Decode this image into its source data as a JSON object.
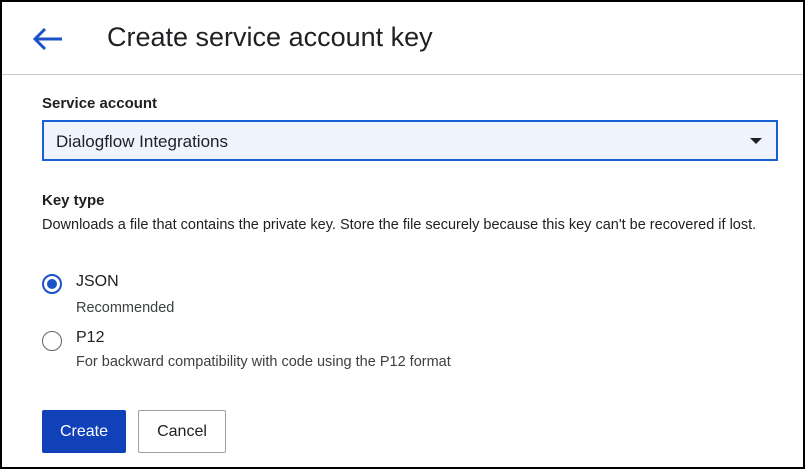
{
  "header": {
    "back_icon": "arrow-left-icon",
    "title": "Create service account key"
  },
  "service_account": {
    "label": "Service account",
    "selected": "Dialogflow Integrations",
    "dropdown_icon": "caret-down-icon"
  },
  "key_type": {
    "label": "Key type",
    "description": "Downloads a file that contains the private key. Store the file securely because this key can't be recovered if lost.",
    "options": [
      {
        "label": "JSON",
        "sublabel": "Recommended",
        "checked": true
      },
      {
        "label": "P12",
        "sublabel": "For backward compatibility with code using the P12 format",
        "checked": false
      }
    ]
  },
  "actions": {
    "create_label": "Create",
    "cancel_label": "Cancel"
  },
  "colors": {
    "accent": "#1a53c9",
    "primary_button": "#1041b8",
    "select_background": "#eef3fd"
  }
}
